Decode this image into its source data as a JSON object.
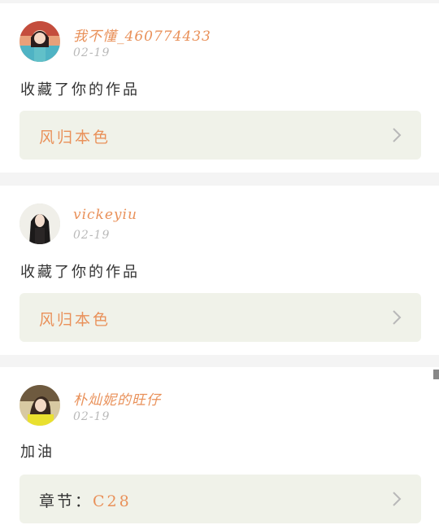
{
  "comments": [
    {
      "username": "我不懂_460774433",
      "date": "02-19",
      "message": "收藏了你的作品",
      "reference": {
        "prefix": "",
        "value": "风归本色"
      }
    },
    {
      "username": "vickeyiu",
      "date": "02-19",
      "message": "收藏了你的作品",
      "reference": {
        "prefix": "",
        "value": "风归本色"
      }
    },
    {
      "username": "朴灿妮的旺仔",
      "date": "02-19",
      "message": "加油",
      "reference": {
        "prefix": "章节：",
        "value": "C28"
      }
    }
  ],
  "colors": {
    "accent": "#e9915a",
    "reference_bg": "#f0f2e9",
    "date": "#b9b9b9",
    "text": "#333333"
  },
  "icons": {
    "reference_chevron": "chevron-right-icon",
    "avatar": "avatar"
  }
}
